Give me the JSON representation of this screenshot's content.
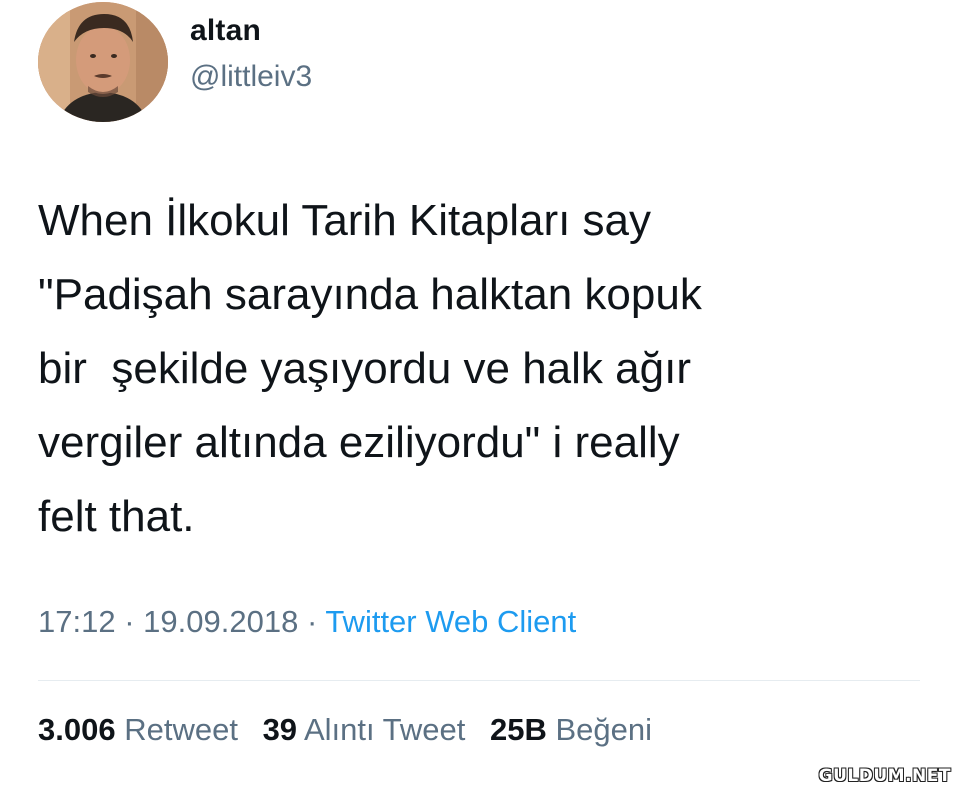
{
  "author": {
    "name": "altan",
    "handle": "@littleiv3",
    "avatar": "profile-photo"
  },
  "tweet": {
    "lines": [
      "When İlkokul Tarih Kitapları say",
      "\"Padişah sarayında halktan kopuk",
      "bir  şekilde yaşıyordu ve halk ağır",
      "vergiler altında eziliyordu\" i really",
      "felt that."
    ]
  },
  "meta": {
    "time": "17:12",
    "separator": "·",
    "date": "19.09.2018",
    "source": "Twitter Web Client"
  },
  "stats": {
    "retweets": {
      "count": "3.006",
      "label": "Retweet"
    },
    "quotes": {
      "count": "39",
      "label": "Alıntı Tweet"
    },
    "likes": {
      "count": "25B",
      "label": "Beğeni"
    }
  },
  "watermark": "GULDUM.NET",
  "colors": {
    "text": "#0f1419",
    "secondary": "#5b7083",
    "link": "#1d9bf0",
    "divider": "#e6ecf0"
  }
}
